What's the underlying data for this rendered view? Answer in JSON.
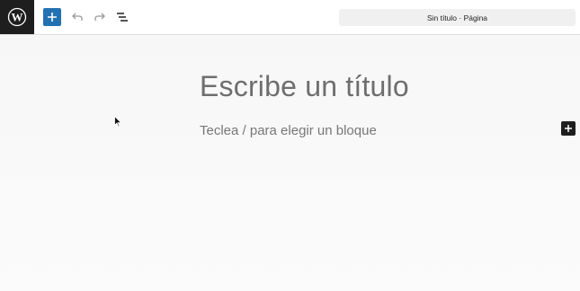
{
  "toolbar": {
    "logo_icon": "wordpress-icon",
    "add_block_icon": "plus-icon",
    "undo_icon": "undo-icon",
    "redo_icon": "redo-icon",
    "list_view_icon": "list-view-icon",
    "document_title": "Sin título · Página",
    "accent_color": "#2271b1"
  },
  "editor": {
    "title_placeholder": "Escribe un título",
    "block_placeholder": "Teclea / para elegir un bloque",
    "inserter_icon": "plus-icon"
  }
}
